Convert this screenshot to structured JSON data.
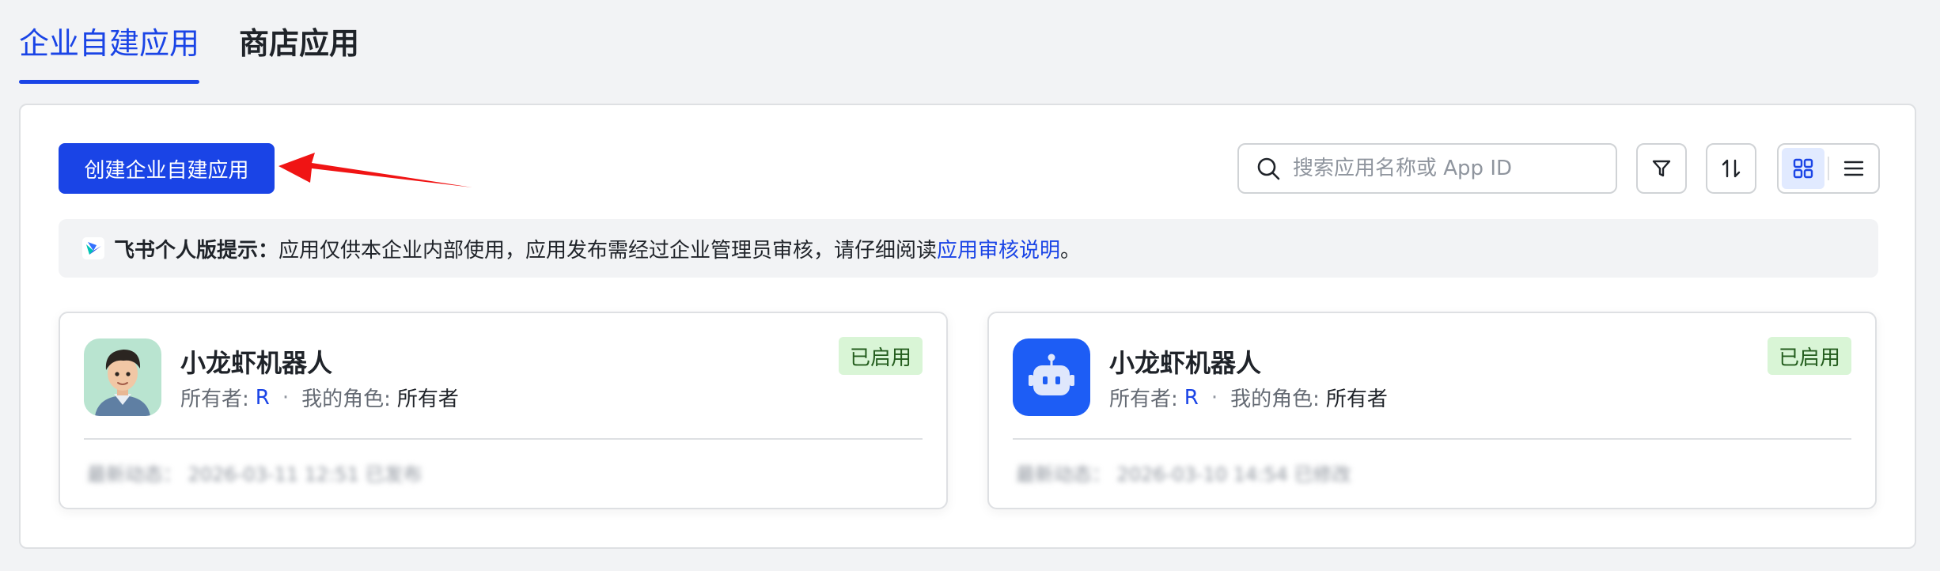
{
  "tabs": [
    {
      "label": "企业自建应用",
      "active": true
    },
    {
      "label": "商店应用",
      "active": false
    }
  ],
  "toolbar": {
    "create_label": "创建企业自建应用",
    "search_placeholder": "搜索应用名称或 App ID"
  },
  "notice": {
    "label": "飞书个人版提示：",
    "text": "应用仅供本企业内部使用，应用发布需经过企业管理员审核，请仔细阅读 ",
    "link": "应用审核说明",
    "end": "。"
  },
  "cards": [
    {
      "name": "小龙虾机器人",
      "badge": "已启用",
      "owner_label": "所有者:",
      "owner_value": "R",
      "separator": "·",
      "role_label": "我的角色:",
      "role_value": "所有者",
      "activity": "最新动态： 2026-03-11 12:51 已发布",
      "avatar": "cartoon-boy-avatar"
    },
    {
      "name": "小龙虾机器人",
      "badge": "已启用",
      "owner_label": "所有者:",
      "owner_value": "R",
      "separator": "·",
      "role_label": "我的角色:",
      "role_value": "所有者",
      "activity": "最新动态： 2026-03-10 14:54 已修改",
      "avatar": "robot-icon"
    }
  ],
  "colors": {
    "accent": "#1a44e6",
    "annotation_arrow": "#f01414",
    "badge_bg": "#d9f5d6",
    "badge_text": "#245d1e"
  }
}
